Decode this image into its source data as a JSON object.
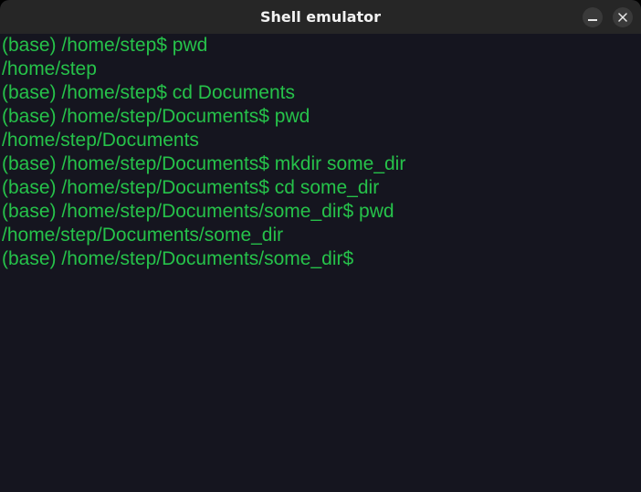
{
  "window": {
    "title": "Shell emulator",
    "minimize_icon": "minimize-icon",
    "close_icon": "close-icon"
  },
  "terminal": {
    "text_color": "#26c24a",
    "background_color": "#15151f",
    "lines": [
      "(base) /home/step$ pwd",
      "/home/step",
      "(base) /home/step$ cd Documents",
      "(base) /home/step/Documents$ pwd",
      "/home/step/Documents",
      "(base) /home/step/Documents$ mkdir some_dir",
      "(base) /home/step/Documents$ cd some_dir",
      "(base) /home/step/Documents/some_dir$ pwd",
      "/home/step/Documents/some_dir",
      "(base) /home/step/Documents/some_dir$"
    ]
  }
}
